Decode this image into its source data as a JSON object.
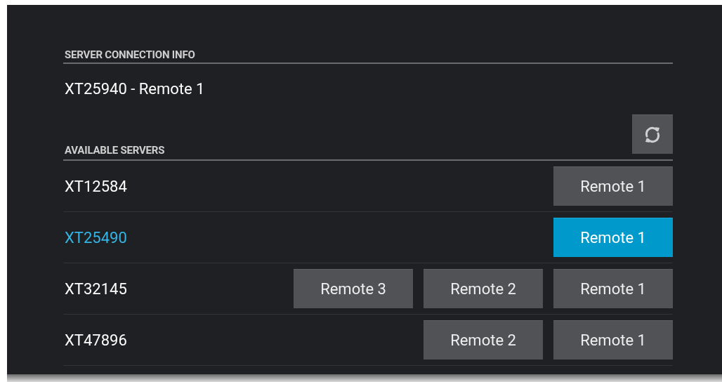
{
  "connection_info": {
    "heading": "SERVER CONNECTION INFO",
    "value": "XT25940 - Remote 1"
  },
  "available_servers": {
    "heading": "AVAILABLE SERVERS",
    "servers": [
      {
        "name": "XT12584",
        "selected": false,
        "remotes": [
          {
            "label": "Remote 1",
            "selected": false
          }
        ]
      },
      {
        "name": "XT25490",
        "selected": true,
        "remotes": [
          {
            "label": "Remote 1",
            "selected": true
          }
        ]
      },
      {
        "name": "XT32145",
        "selected": false,
        "remotes": [
          {
            "label": "Remote 3",
            "selected": false
          },
          {
            "label": "Remote 2",
            "selected": false
          },
          {
            "label": "Remote 1",
            "selected": false
          }
        ]
      },
      {
        "name": "XT47896",
        "selected": false,
        "remotes": [
          {
            "label": "Remote 2",
            "selected": false
          },
          {
            "label": "Remote 1",
            "selected": false
          }
        ]
      }
    ]
  }
}
